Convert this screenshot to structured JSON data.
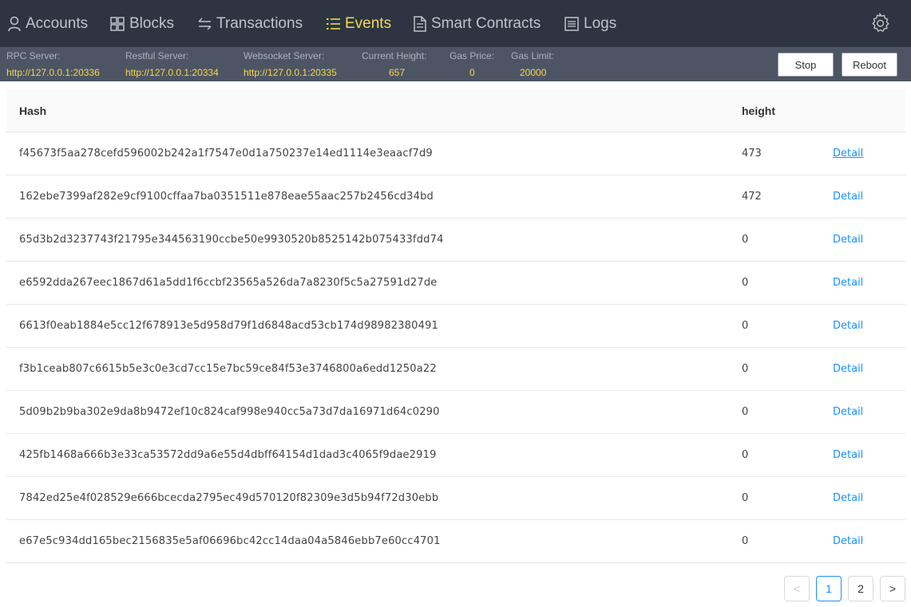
{
  "nav": {
    "items": [
      {
        "label": "Accounts",
        "icon": "user-icon"
      },
      {
        "label": "Blocks",
        "icon": "grid-icon"
      },
      {
        "label": "Transactions",
        "icon": "swap-icon"
      },
      {
        "label": "Events",
        "icon": "list-icon",
        "active": true
      },
      {
        "label": "Smart Contracts",
        "icon": "file-icon"
      },
      {
        "label": "Logs",
        "icon": "log-icon"
      }
    ],
    "settings_icon": "gear-icon",
    "accent_color": "#f5d94e"
  },
  "status": {
    "rpc_label": "RPC Server:",
    "rpc_value": "http://127.0.0.1:20336",
    "restful_label": "Restful Server:",
    "restful_value": "http://127.0.0.1:20334",
    "ws_label": "Websocket Server:",
    "ws_value": "http://127.0.0.1:20335",
    "height_label": "Current Height:",
    "height_value": "657",
    "gas_price_label": "Gas Price:",
    "gas_price_value": "0",
    "gas_limit_label": "Gas Limit:",
    "gas_limit_value": "20000",
    "stop_label": "Stop",
    "reboot_label": "Reboot"
  },
  "table": {
    "headers": {
      "hash": "Hash",
      "height": "height"
    },
    "detail_label": "Detail",
    "rows": [
      {
        "hash": "f45673f5aa278cefd596002b242a1f7547e0d1a750237e14ed1114e3eaacf7d9",
        "height": "473"
      },
      {
        "hash": "162ebe7399af282e9cf9100cffaa7ba0351511e878eae55aac257b2456cd34bd",
        "height": "472"
      },
      {
        "hash": "65d3b2d3237743f21795e344563190ccbe50e9930520b8525142b075433fdd74",
        "height": "0"
      },
      {
        "hash": "e6592dda267eec1867d61a5dd1f6ccbf23565a526da7a8230f5c5a27591d27de",
        "height": "0"
      },
      {
        "hash": "6613f0eab1884e5cc12f678913e5d958d79f1d6848acd53cb174d98982380491",
        "height": "0"
      },
      {
        "hash": "f3b1ceab807c6615b5e3c0e3cd7cc15e7bc59ce84f53e3746800a6edd1250a22",
        "height": "0"
      },
      {
        "hash": "5d09b2b9ba302e9da8b9472ef10c824caf998e940cc5a73d7da16971d64c0290",
        "height": "0"
      },
      {
        "hash": "425fb1468a666b3e33ca53572dd9a6e55d4dbff64154d1dad3c4065f9dae2919",
        "height": "0"
      },
      {
        "hash": "7842ed25e4f028529e666bcecda2795ec49d570120f82309e3d5b94f72d30ebb",
        "height": "0"
      },
      {
        "hash": "e67e5c934dd165bec2156835e5af06696bc42cc14daa04a5846ebb7e60cc4701",
        "height": "0"
      }
    ]
  },
  "pagination": {
    "prev": "<",
    "pages": [
      "1",
      "2"
    ],
    "current": "1",
    "next": ">"
  }
}
